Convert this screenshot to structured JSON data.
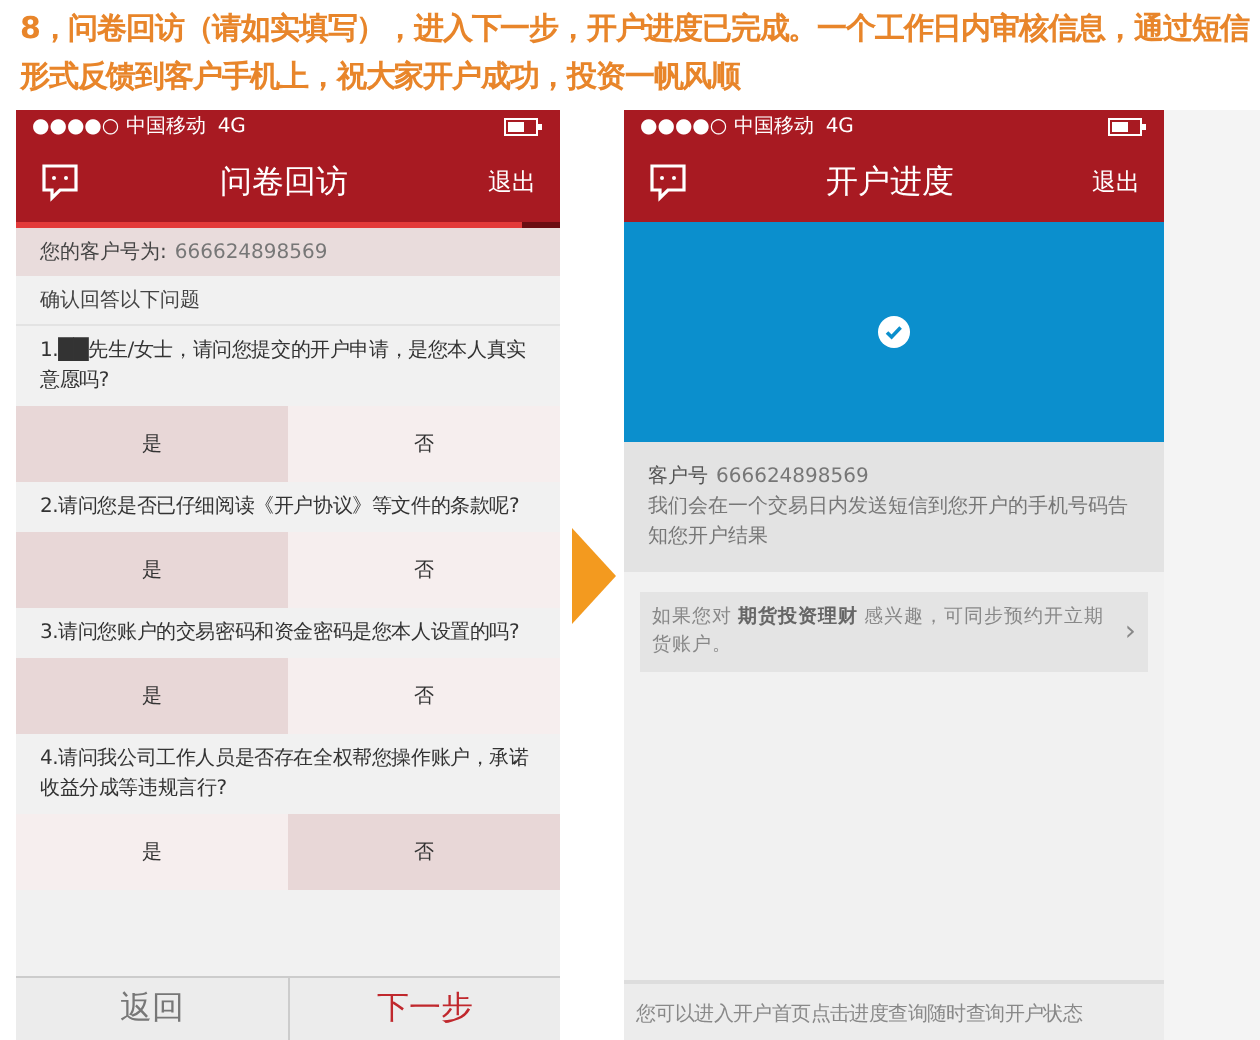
{
  "intro": "8，问卷回访（请如实填写），进入下一步，开户进度已完成。一个工作日内审核信息，通过短信形式反馈到客户手机上，祝大家开户成功，投资一帆风顺",
  "survey_screen": {
    "status_bar": {
      "carrier": "●●●●○ 中国移动",
      "network": "4G"
    },
    "title": "问卷回访",
    "exit": "退出",
    "level": 0.93,
    "customer_label": "您的客户号为:",
    "customer_number": "666624898569",
    "instruction": "确认回答以下问题",
    "questions": [
      {
        "text": "1.██先生/女士，请问您提交的开户申请，是您本人真实意愿吗?",
        "options": [
          {
            "label": "是",
            "selected": true
          },
          {
            "label": "否",
            "selected": false
          }
        ]
      },
      {
        "text": "2.请问您是否已仔细阅读《开户协议》等文件的条款呢?",
        "options": [
          {
            "label": "是",
            "selected": true
          },
          {
            "label": "否",
            "selected": false
          }
        ]
      },
      {
        "text": "3.请问您账户的交易密码和资金密码是您本人设置的吗?",
        "options": [
          {
            "label": "是",
            "selected": true
          },
          {
            "label": "否",
            "selected": false
          }
        ]
      },
      {
        "text": "4.请问我公司工作人员是否存在全权帮您操作账户，承诺收益分成等违规言行?",
        "options": [
          {
            "label": "是",
            "selected": false
          },
          {
            "label": "否",
            "selected": true
          }
        ]
      }
    ],
    "back_button": "返回",
    "next_button": "下一步"
  },
  "progress_screen": {
    "status_bar": {
      "carrier": "●●●●○ 中国移动",
      "network": "4G"
    },
    "title": "开户进度",
    "exit": "退出",
    "customer_label": "客户号",
    "customer_number": "666624898569",
    "message": "我们会在一个交易日内发送短信到您开户的手机号码告知您开户结果",
    "promo": "如果您对 **期货投资理财** 感兴趣，可同步预约开立期货账户。",
    "promo_arrow": "›",
    "footer": "您可以进入开户首页点击进度查询随时查询开户状态"
  }
}
